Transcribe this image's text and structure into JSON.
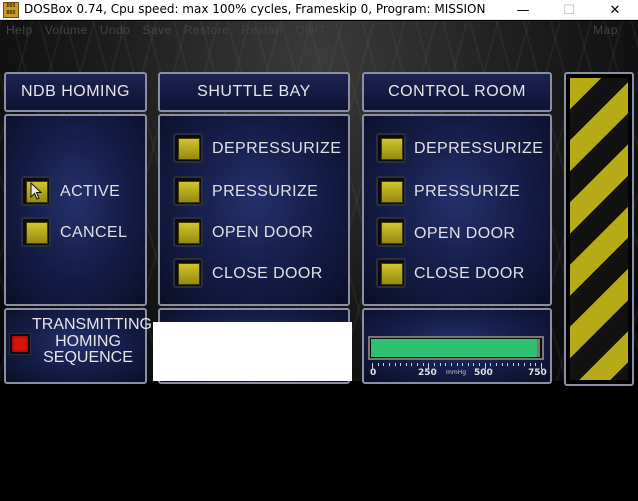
{
  "window": {
    "title": "DOSBox 0.74, Cpu speed: max 100% cycles, Frameskip  0, Program:  MISSION",
    "icon_text": "DOS\nBOX",
    "controls": {
      "minimize": "—",
      "maximize": "☐",
      "close": "✕"
    }
  },
  "menubar": {
    "items": [
      "Help",
      "Volume",
      "Undo",
      "Save",
      "Restore",
      "Restart",
      "QUIT"
    ],
    "map": "Map"
  },
  "panels": {
    "ndb": {
      "title": "NDB HOMING",
      "buttons": [
        {
          "label": "ACTIVE"
        },
        {
          "label": "CANCEL"
        }
      ],
      "status": {
        "line1": "TRANSMITTING",
        "line2": "HOMING",
        "line3": "SEQUENCE"
      }
    },
    "shuttle_bay": {
      "title": "SHUTTLE BAY",
      "buttons": [
        {
          "label": "DEPRESSURIZE"
        },
        {
          "label": "PRESSURIZE"
        },
        {
          "label": "OPEN DOOR"
        },
        {
          "label": "CLOSE DOOR"
        }
      ]
    },
    "control_room": {
      "title": "CONTROL ROOM",
      "buttons": [
        {
          "label": "DEPRESSURIZE"
        },
        {
          "label": "PRESSURIZE"
        },
        {
          "label": "OPEN DOOR"
        },
        {
          "label": "CLOSE DOOR"
        }
      ],
      "gauge": {
        "tick_labels": [
          "0",
          "250",
          "500",
          "750"
        ],
        "unit": "mmHg",
        "max": 750,
        "value": 740,
        "fill_color": "#2fbf70"
      }
    }
  },
  "colors": {
    "panel_border": "#8a8fa3",
    "panel_bg": "#141c45",
    "button_yellow": "#c3b71f",
    "status_red": "#d6150c",
    "hazard_yellow": "#b6ab16"
  },
  "icons": {
    "cursor": "arrow-cursor-icon",
    "status_light": "red-indicator-icon"
  }
}
